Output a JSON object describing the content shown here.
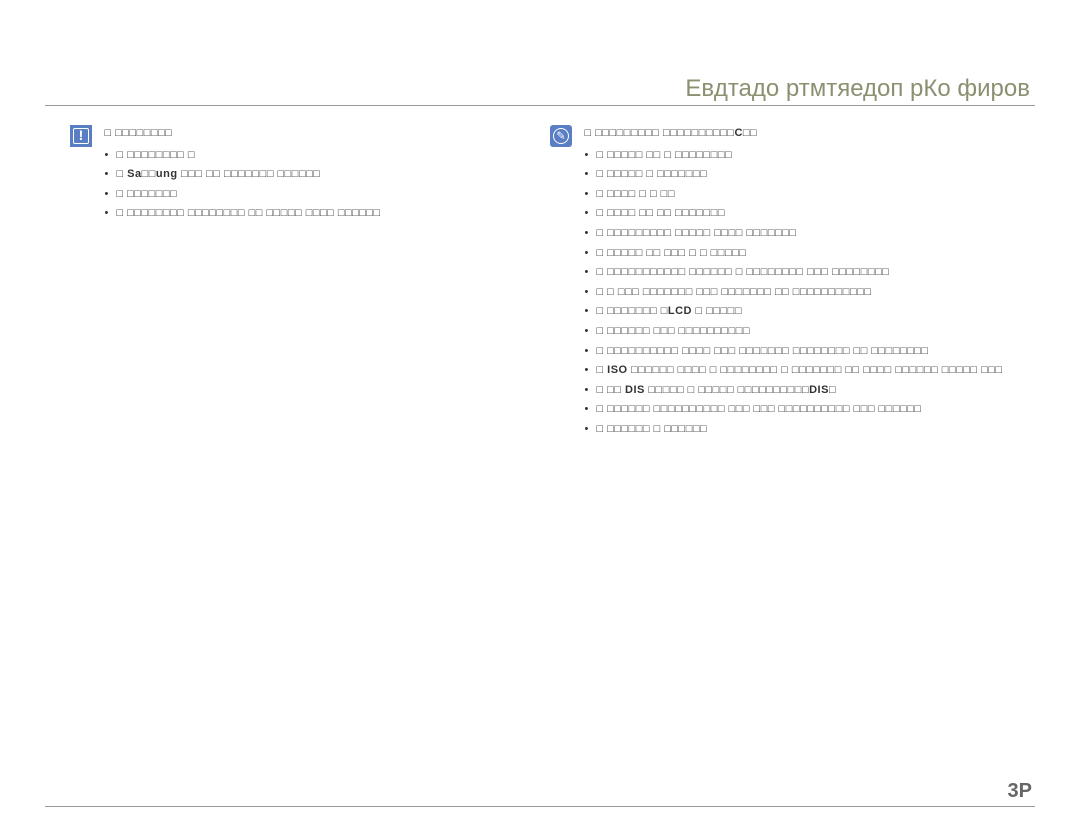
{
  "header": {
    "title": "Евдтадо ртмтяедоп рКо фиров"
  },
  "pageNumber": "3P",
  "leftColumn": {
    "title": "□ □□□□□□□□",
    "items": [
      "□ □□□□□□□□ □",
      "□ Sa□□ung □□□ □□ □□□□□□□ □□□□□□",
      "□ □□□□□□□",
      "□ □□□□□□□□ □□□□□□□□ □□ □□□□□ □□□□ □□□□□□"
    ]
  },
  "rightColumn": {
    "title": "□ □□□□□□□□□ □□□□□□□□□□С□□",
    "items": [
      "□ □□□□□ □□ □ □□□□□□□□",
      "□ □□□□□ □ □□□□□□□",
      "□ □□□□ □ □ □□",
      "□ □□□□ □□ □□ □□□□□□□",
      "□ □□□□□□□□□ □□□□□ □□□□ □□□□□□□",
      "□ □□□□□ □□ □□□ □ □ □□□□□",
      "□ □□□□□□□□□□□ □□□□□□ □ □□□□□□□□ □□□ □□□□□□□□",
      "□ □ □□□ □□□□□□□ □□□ □□□□□□□ □□ □□□□□□□□□□□",
      "□ □□□□□□□ □LCD □ □□□□□",
      "□ □□□□□□ □□□ □□□□□□□□□□",
      "□ □□□□□□□□□□ □□□□ □□□ □□□□□□□ □□□□□□□□ □□ □□□□□□□□",
      "□ ISO □□□□□□ □□□□ □ □□□□□□□□ □ □□□□□□□ □□ □□□□ □□□□□□ □□□□□ □□□",
      "□ □□ DIS □□□□□ □ □□□□□ □□□□□□□□□□DIS□",
      "□ □□□□□□ □□□□□□□□□□ □□□ □□□ □□□□□□□□□□ □□□ □□□□□□",
      "□ □□□□□□ □ □□□□□□"
    ]
  }
}
